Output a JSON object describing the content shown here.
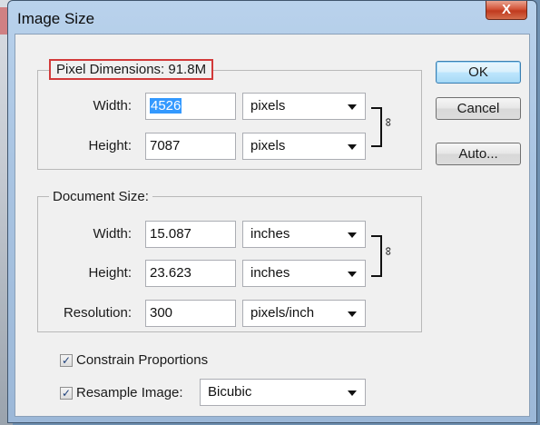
{
  "dialog": {
    "title": "Image Size",
    "close_symbol": "X"
  },
  "pixel_dimensions": {
    "legend": "Pixel Dimensions:  91.8M",
    "width_label": "Width:",
    "width_value": "4526",
    "width_unit": "pixels",
    "height_label": "Height:",
    "height_value": "7087",
    "height_unit": "pixels"
  },
  "document_size": {
    "legend": "Document Size:",
    "width_label": "Width:",
    "width_value": "15.087",
    "width_unit": "inches",
    "height_label": "Height:",
    "height_value": "23.623",
    "height_unit": "inches",
    "resolution_label": "Resolution:",
    "resolution_value": "300",
    "resolution_unit": "pixels/inch"
  },
  "options": {
    "constrain_label": "Constrain Proportions",
    "constrain_checked": true,
    "resample_label": "Resample Image:",
    "resample_checked": true,
    "resample_method": "Bicubic"
  },
  "buttons": {
    "ok": "OK",
    "cancel": "Cancel",
    "auto": "Auto..."
  },
  "icons": {
    "check": "✓",
    "chain": "∞"
  }
}
